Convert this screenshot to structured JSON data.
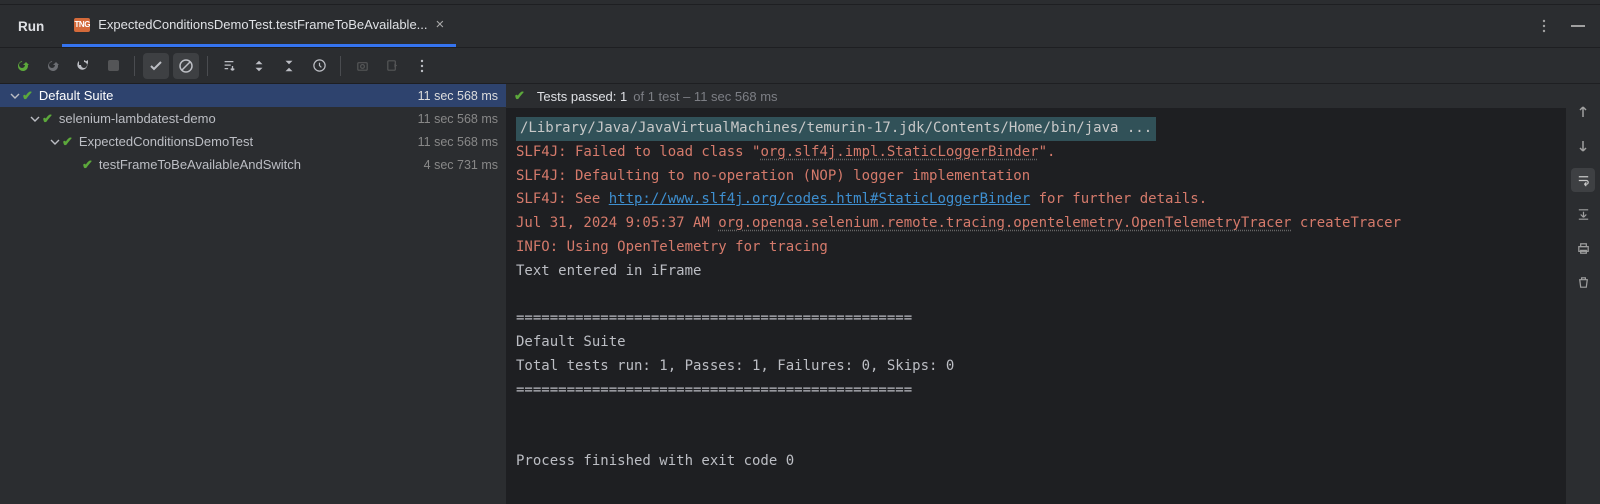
{
  "header": {
    "run_label": "Run",
    "tab_icon_text": "TNG",
    "tab_label": "ExpectedConditionsDemoTest.testFrameToBeAvailable...",
    "tab_close": "×"
  },
  "tree": [
    {
      "level": 0,
      "chevron": true,
      "name": "Default Suite",
      "time": "11 sec 568 ms",
      "selected": true
    },
    {
      "level": 1,
      "chevron": true,
      "name": "selenium-lambdatest-demo",
      "time": "11 sec 568 ms"
    },
    {
      "level": 2,
      "chevron": true,
      "name": "ExpectedConditionsDemoTest",
      "time": "11 sec 568 ms"
    },
    {
      "level": 3,
      "chevron": false,
      "name": "testFrameToBeAvailableAndSwitch",
      "time": "4 sec 731 ms"
    }
  ],
  "status": {
    "passed_prefix": "Tests passed: 1",
    "passed_suffix": " of 1 test – 11 sec 568 ms"
  },
  "console": {
    "cmd": "/Library/Java/JavaVirtualMachines/temurin-17.jdk/Contents/Home/bin/java ...",
    "l1a": "SLF4J: Failed to load class \"",
    "l1b": "org.slf4j.impl.StaticLoggerBinder",
    "l1c": "\".",
    "l2": "SLF4J: Defaulting to no-operation (NOP) logger implementation",
    "l3a": "SLF4J: See ",
    "l3link": "http://www.slf4j.org/codes.html#StaticLoggerBinder",
    "l3b": " for further details.",
    "l4a": "Jul 31, 2024 9:05:37 AM ",
    "l4b": "org.openqa.selenium.remote.tracing.opentelemetry.OpenTelemetryTracer",
    "l4c": " createTracer",
    "l5": "INFO: Using OpenTelemetry for tracing",
    "l6": "Text entered in iFrame",
    "sep": "===============================================",
    "l7": "Default Suite",
    "l8": "Total tests run: 1, Passes: 1, Failures: 0, Skips: 0",
    "l9": "Process finished with exit code 0"
  }
}
